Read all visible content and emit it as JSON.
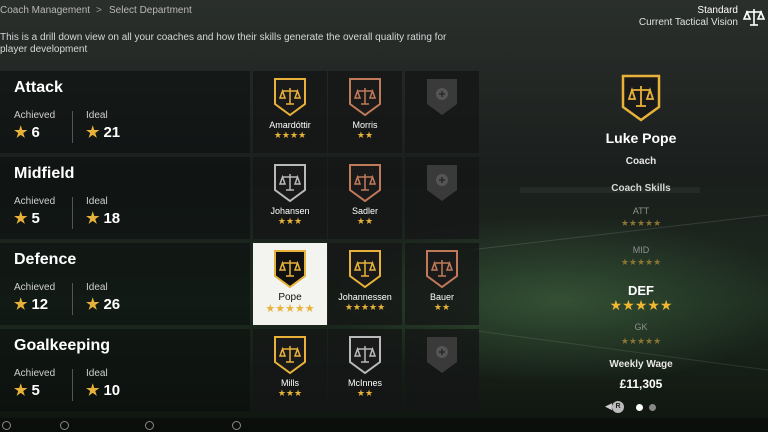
{
  "breadcrumb": {
    "parent": "Coach Management",
    "separator": ">",
    "current": "Select Department"
  },
  "tactical_vision": {
    "value": "Standard",
    "label": "Current Tactical Vision",
    "icon": "scales-icon"
  },
  "description": "This is a drill down view on all your coaches and how their skills generate the overall quality rating for player development",
  "departments": [
    {
      "name": "Attack",
      "achieved_label": "Achieved",
      "achieved": "6",
      "ideal_label": "Ideal",
      "ideal": "21",
      "coaches": [
        {
          "name": "Amardóttir",
          "stars": "★★★★",
          "color": "#e8b23a"
        },
        {
          "name": "Morris",
          "stars": "★★",
          "color": "#c07a5a"
        }
      ]
    },
    {
      "name": "Midfield",
      "achieved_label": "Achieved",
      "achieved": "5",
      "ideal_label": "Ideal",
      "ideal": "18",
      "coaches": [
        {
          "name": "Johansen",
          "stars": "★★★",
          "color": "#b9b9b9"
        },
        {
          "name": "Sadler",
          "stars": "★★",
          "color": "#c07a5a"
        }
      ]
    },
    {
      "name": "Defence",
      "achieved_label": "Achieved",
      "achieved": "12",
      "ideal_label": "Ideal",
      "ideal": "26",
      "coaches": [
        {
          "name": "Pope",
          "stars": "★★★★★",
          "color": "#e8b23a"
        },
        {
          "name": "Johannessen",
          "stars": "★★★★★",
          "color": "#e8b23a"
        },
        {
          "name": "Bauer",
          "stars": "★★",
          "color": "#c07a5a"
        }
      ]
    },
    {
      "name": "Goalkeeping",
      "achieved_label": "Achieved",
      "achieved": "5",
      "ideal_label": "Ideal",
      "ideal": "10",
      "coaches": [
        {
          "name": "Mills",
          "stars": "★★★",
          "color": "#e8b23a"
        },
        {
          "name": "McInnes",
          "stars": "★★",
          "color": "#b9b9b9"
        }
      ]
    }
  ],
  "detail": {
    "name": "Luke Pope",
    "role": "Coach",
    "skills_label": "Coach Skills",
    "skills": [
      {
        "label": "ATT",
        "stars": "★★★★★"
      },
      {
        "label": "MID",
        "stars": "★★★★★"
      },
      {
        "label": "DEF",
        "stars": "★★★★★"
      },
      {
        "label": "GK",
        "stars": "★★★★★"
      }
    ],
    "wage_label": "Weekly Wage",
    "wage": "£11,305"
  },
  "pager": {
    "button": "R",
    "arrow": "◀",
    "pages": 2,
    "active": 1
  },
  "colors": {
    "gold": "#e8b23a",
    "silver": "#b9b9b9",
    "bronze": "#c07a5a",
    "selected_bg": "#f3f3f0"
  }
}
